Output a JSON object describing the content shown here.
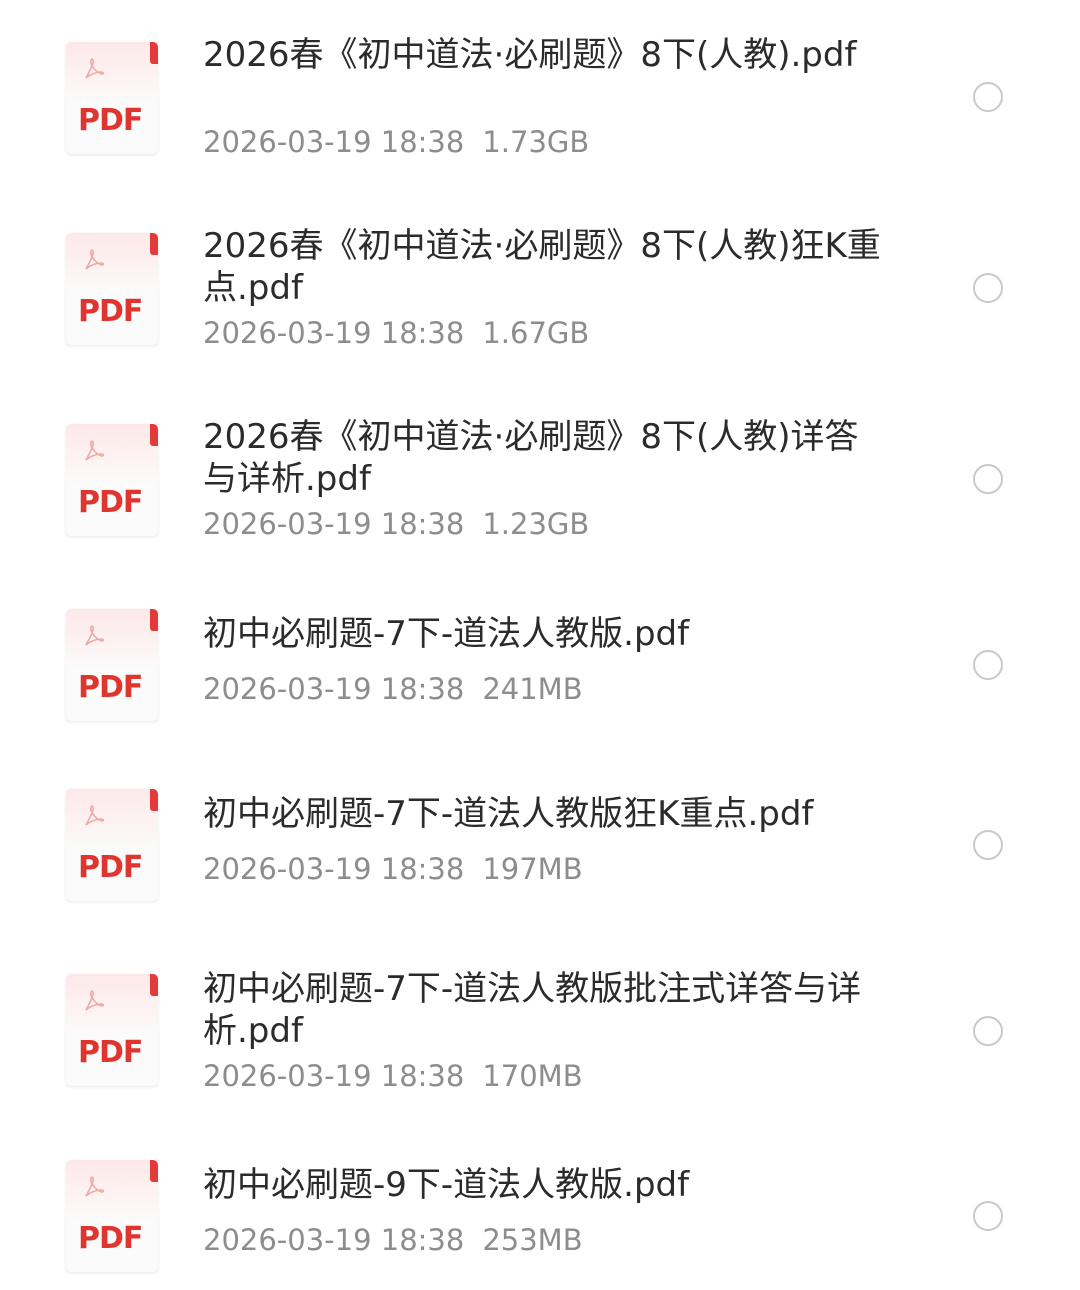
{
  "files": [
    {
      "name": "2026春《初中道法·必刷题》8下(人教).pdf",
      "date": "2026-03-19 18:38",
      "size": "1.73GB",
      "icon": "pdf-file-icon",
      "icon_label": "PDF",
      "selected": false
    },
    {
      "name": "2026春《初中道法·必刷题》8下(人教)狂K重点.pdf",
      "date": "2026-03-19 18:38",
      "size": "1.67GB",
      "icon": "pdf-file-icon",
      "icon_label": "PDF",
      "selected": false
    },
    {
      "name": "2026春《初中道法·必刷题》8下(人教)详答与详析.pdf",
      "date": "2026-03-19 18:38",
      "size": "1.23GB",
      "icon": "pdf-file-icon",
      "icon_label": "PDF",
      "selected": false
    },
    {
      "name": "初中必刷题-7下-道法人教版.pdf",
      "date": "2026-03-19 18:38",
      "size": "241MB",
      "icon": "pdf-file-icon",
      "icon_label": "PDF",
      "selected": false
    },
    {
      "name": "初中必刷题-7下-道法人教版狂K重点.pdf",
      "date": "2026-03-19 18:38",
      "size": "197MB",
      "icon": "pdf-file-icon",
      "icon_label": "PDF",
      "selected": false
    },
    {
      "name": "初中必刷题-7下-道法人教版批注式详答与详析.pdf",
      "date": "2026-03-19 18:38",
      "size": "170MB",
      "icon": "pdf-file-icon",
      "icon_label": "PDF",
      "selected": false
    },
    {
      "name": "初中必刷题-9下-道法人教版.pdf",
      "date": "2026-03-19 18:38",
      "size": "253MB",
      "icon": "pdf-file-icon",
      "icon_label": "PDF",
      "selected": false
    }
  ],
  "colors": {
    "pdf_red": "#e0342f",
    "name_text": "#2b2b2b",
    "meta_text": "#8d8d8d",
    "radio_border": "#c9c9c9"
  }
}
